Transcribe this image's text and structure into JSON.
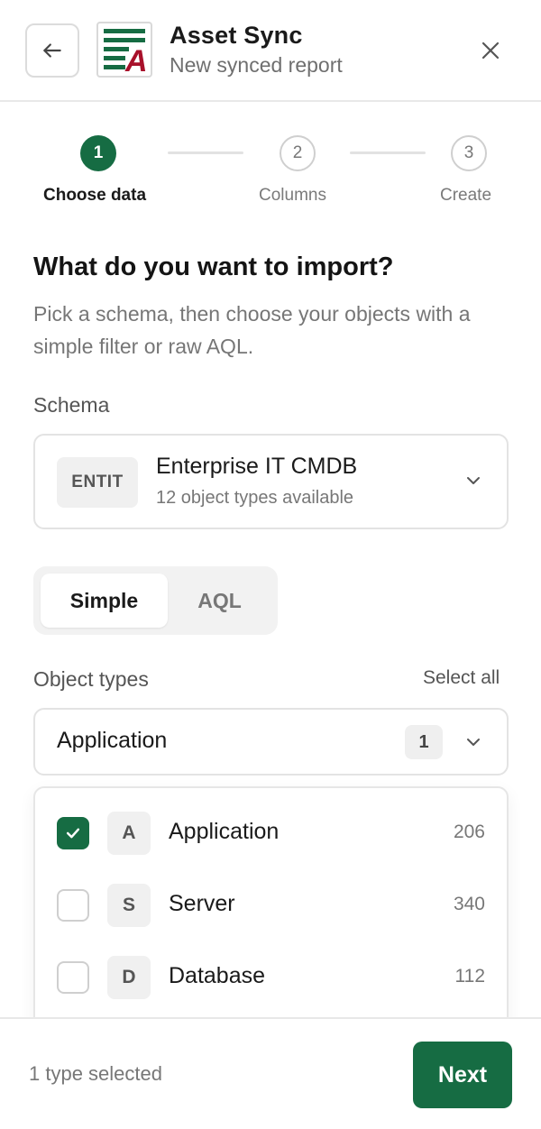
{
  "header": {
    "title": "Asset Sync",
    "subtitle": "New synced report",
    "logo_letter": "A",
    "brand_color": "#166c43",
    "logo_accent": "#a8102a"
  },
  "stepper": {
    "steps": [
      {
        "number": "1",
        "label": "Choose data",
        "state": "active"
      },
      {
        "number": "2",
        "label": "Columns",
        "state": "upcoming"
      },
      {
        "number": "3",
        "label": "Create",
        "state": "upcoming"
      }
    ]
  },
  "intro": {
    "heading": "What do you want to import?",
    "description": "Pick a schema, then choose your objects with a simple filter or raw AQL."
  },
  "schema": {
    "label": "Schema",
    "badge": "ENTIT",
    "name": "Enterprise IT CMDB",
    "meta": "12 object types available"
  },
  "mode": {
    "options": [
      "Simple",
      "AQL"
    ],
    "selected": "Simple"
  },
  "object_types": {
    "label": "Object types",
    "select_all": "Select all",
    "selected_value": "Application",
    "selected_count": "1",
    "options": [
      {
        "letter": "A",
        "name": "Application",
        "count": "206",
        "checked": true
      },
      {
        "letter": "S",
        "name": "Server",
        "count": "340",
        "checked": false
      },
      {
        "letter": "D",
        "name": "Database",
        "count": "112",
        "checked": false
      }
    ]
  },
  "footer": {
    "status": "1 type selected",
    "next_label": "Next"
  }
}
